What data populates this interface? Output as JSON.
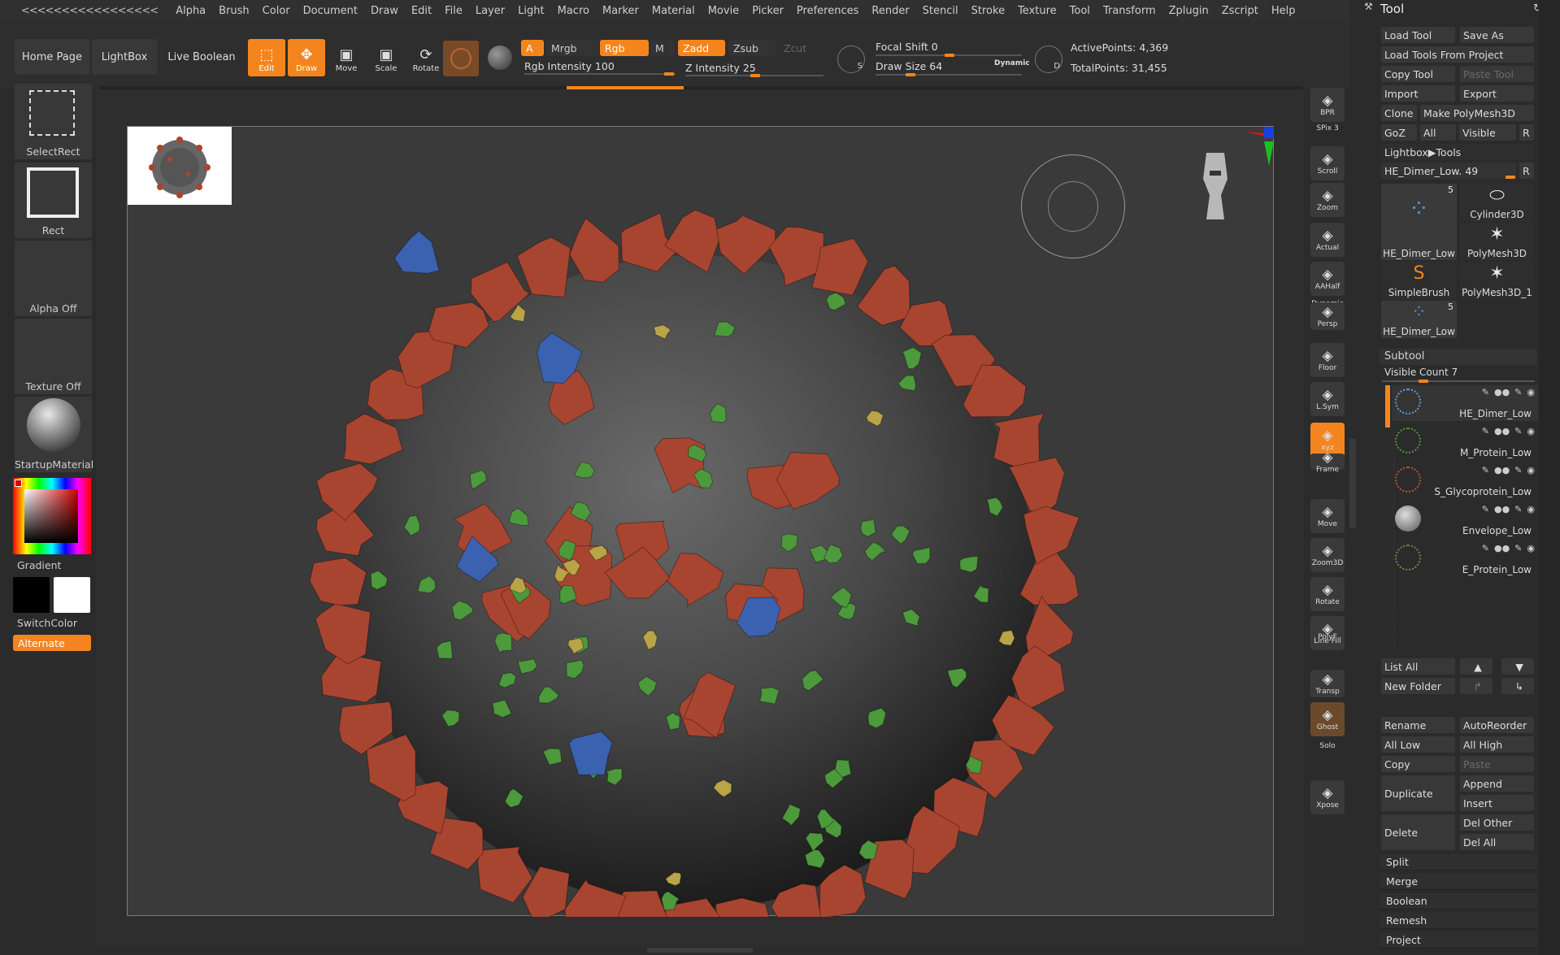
{
  "menu": {
    "collapse": "<<<<<<<<<<<<<<<<<",
    "items": [
      "Alpha",
      "Brush",
      "Color",
      "Document",
      "Draw",
      "Edit",
      "File",
      "Layer",
      "Light",
      "Macro",
      "Marker",
      "Material",
      "Movie",
      "Picker",
      "Preferences",
      "Render",
      "Stencil",
      "Stroke",
      "Texture",
      "Tool",
      "Transform",
      "Zplugin",
      "Zscript",
      "Help"
    ]
  },
  "shelf": {
    "home_page": "Home Page",
    "lightbox": "LightBox",
    "live_boolean": "Live Boolean",
    "edit": "Edit",
    "draw": "Draw",
    "move": "Move",
    "scale": "Scale",
    "rotate": "Rotate",
    "a_label": "A",
    "mrgb": "Mrgb",
    "rgb": "Rgb",
    "m": "M",
    "zadd": "Zadd",
    "zsub": "Zsub",
    "zcut": "Zcut",
    "rgb_intensity": "Rgb Intensity 100",
    "z_intensity": "Z Intensity 25",
    "focal_shift": "Focal Shift 0",
    "draw_size": "Draw Size 64",
    "dynamic": "Dynamic",
    "active_points": "ActivePoints: 4,369",
    "total_points": "TotalPoints: 31,455",
    "s_key": "S",
    "d_key": "D"
  },
  "left": {
    "select_rect": "SelectRect",
    "rect": "Rect",
    "alpha_off": "Alpha Off",
    "texture_off": "Texture Off",
    "startup_material": "StartupMaterial",
    "gradient": "Gradient",
    "switch_color": "SwitchColor",
    "alternate": "Alternate"
  },
  "colors": {
    "accent": "#f4851e",
    "spike_red": "#a84530",
    "protein_green": "#4c9a3c",
    "protein_blue": "#3a62b0",
    "protein_yellow": "#b9a448",
    "sphere": "#4a4a4a"
  },
  "right_toolbar": [
    {
      "label": "BPR",
      "icon": "bpr-sphere-icon"
    },
    {
      "label": "SPix 3",
      "icon": "spix-icon"
    },
    {
      "label": "Scroll",
      "icon": "scroll-icon"
    },
    {
      "label": "Zoom",
      "icon": "zoom-icon"
    },
    {
      "label": "Actual",
      "icon": "actual-icon"
    },
    {
      "label": "AAHalf",
      "icon": "aahalf-icon"
    },
    {
      "label": "Dynamic",
      "icon": "dynamic-icon"
    },
    {
      "label": "Persp",
      "icon": "persp-icon"
    },
    {
      "label": "Floor",
      "icon": "floor-icon"
    },
    {
      "label": "L.Sym",
      "icon": "lsym-icon"
    },
    {
      "label": "xyz",
      "icon": "xyz-icon"
    },
    {
      "label": "Frame",
      "icon": "frame-icon"
    },
    {
      "label": "Move",
      "icon": "move-icon"
    },
    {
      "label": "Zoom3D",
      "icon": "zoom3d-icon"
    },
    {
      "label": "Rotate",
      "icon": "rotate-icon"
    },
    {
      "label": "Line Fill",
      "icon": "linefill-icon"
    },
    {
      "label": "PolyF",
      "icon": "polyf-icon"
    },
    {
      "label": "Transp",
      "icon": "transp-icon"
    },
    {
      "label": "Ghost",
      "icon": "ghost-icon"
    },
    {
      "label": "Solo",
      "icon": "solo-icon"
    },
    {
      "label": "Xpose",
      "icon": "xpose-icon"
    }
  ],
  "tool": {
    "title": "Tool",
    "load_tool": "Load Tool",
    "save_as": "Save As",
    "load_from_project": "Load Tools From Project",
    "copy_tool": "Copy Tool",
    "paste_tool": "Paste Tool",
    "import": "Import",
    "export": "Export",
    "clone": "Clone",
    "make_polymesh": "Make PolyMesh3D",
    "goz": "GoZ",
    "all": "All",
    "visible": "Visible",
    "r": "R",
    "lightbox_tools": "Lightbox▶Tools",
    "current_tool": "HE_Dimer_Low. 49",
    "thumbs": [
      {
        "label": "HE_Dimer_Low",
        "badge": "5"
      },
      {
        "label": "Cylinder3D",
        "badge": ""
      },
      {
        "label": "PolyMesh3D",
        "badge": ""
      },
      {
        "label": "SimpleBrush",
        "badge": ""
      },
      {
        "label": "PolyMesh3D_1",
        "badge": ""
      },
      {
        "label": "HE_Dimer_Low",
        "badge": "5"
      }
    ]
  },
  "subtool": {
    "title": "Subtool",
    "visible_count": "Visible Count 7",
    "items": [
      "HE_Dimer_Low",
      "M_Protein_Low",
      "S_Glycoprotein_Low",
      "Envelope_Low",
      "E_Protein_Low"
    ],
    "list_all": "List All",
    "new_folder": "New Folder",
    "rename": "Rename",
    "auto_reorder": "AutoReorder",
    "all_low": "All Low",
    "all_high": "All High",
    "copy": "Copy",
    "paste": "Paste",
    "duplicate": "Duplicate",
    "append": "Append",
    "insert": "Insert",
    "delete": "Delete",
    "del_other": "Del Other",
    "del_all": "Del All",
    "sections": [
      "Split",
      "Merge",
      "Boolean",
      "Remesh",
      "Project"
    ]
  }
}
